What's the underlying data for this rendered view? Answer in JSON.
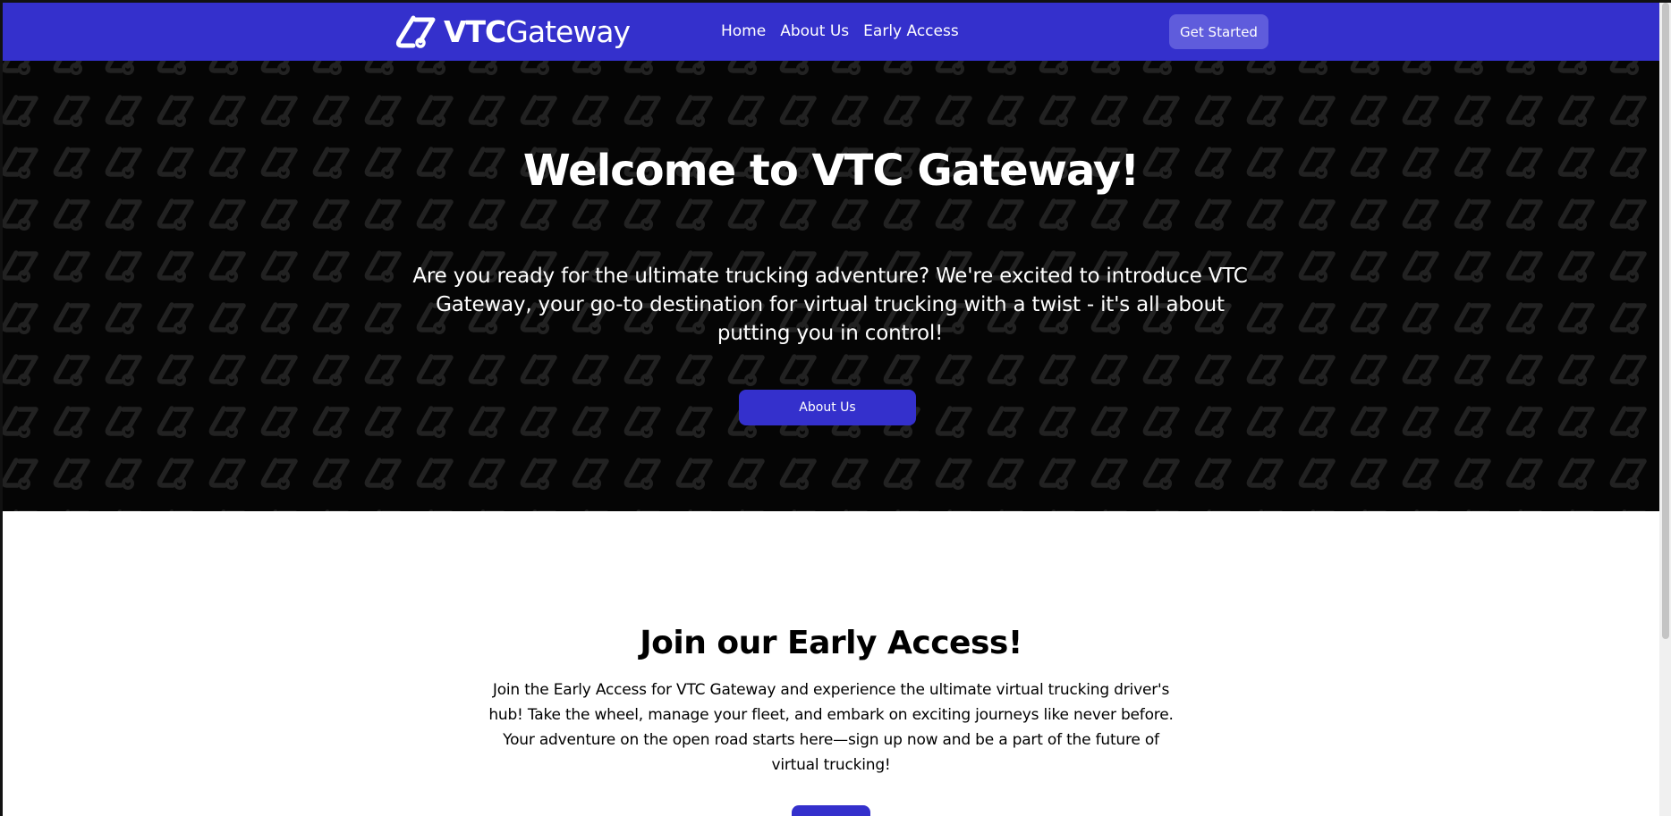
{
  "colors": {
    "brand": "#3430cc",
    "brand_light": "#5f5cdc",
    "hero_bg": "#050505",
    "text_dark": "#000000",
    "text_light": "#ffffff"
  },
  "navbar": {
    "logo_icon": "vtc-logo-icon",
    "logo_text_bold": "VTC",
    "logo_text_regular": "Gateway",
    "links": [
      {
        "label": "Home"
      },
      {
        "label": "About Us"
      },
      {
        "label": "Early Access"
      }
    ],
    "cta_label": "Get Started"
  },
  "hero": {
    "title": "Welcome to VTC Gateway!",
    "text": "Are you ready for the ultimate trucking adventure? We're excited to introduce VTC Gateway, your go-to destination for virtual trucking with a twist - it's all about putting you in control!",
    "button_label": "About Us"
  },
  "early_access": {
    "title": "Join our Early Access!",
    "text": "Join the Early Access for VTC Gateway and experience the ultimate virtual trucking driver's hub! Take the wheel, manage your fleet, and embark on exciting journeys like never before. Your adventure on the open road starts here—sign up now and be a part of the future of virtual trucking!",
    "button_label": ""
  }
}
